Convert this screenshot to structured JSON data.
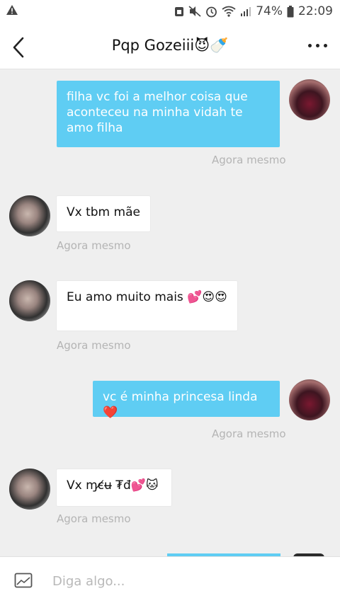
{
  "status_bar": {
    "battery": "74%",
    "time": "22:09"
  },
  "header": {
    "title": "Pqp Gozeiii😈🍼"
  },
  "messages": [
    {
      "direction": "out",
      "text": "filha vc foi a melhor coisa que aconteceu na minha vidah te amo filha",
      "time": "Agora mesmo"
    },
    {
      "direction": "in",
      "text": "Vx tbm mãe",
      "time": "Agora mesmo"
    },
    {
      "direction": "in",
      "text": "Eu amo muito mais 💕😍😍",
      "time": "Agora mesmo"
    },
    {
      "direction": "out",
      "text": "vc é minha princesa linda ❤️",
      "time": "Agora mesmo"
    },
    {
      "direction": "in",
      "text": "Vx ɱє̸ʉ ₮đ💕🐱",
      "time": "Agora mesmo"
    }
  ],
  "composer": {
    "placeholder": "Diga algo..."
  },
  "colors": {
    "outgoing_bubble": "#5fcdf3",
    "incoming_bubble": "#ffffff",
    "background": "#efefef"
  }
}
